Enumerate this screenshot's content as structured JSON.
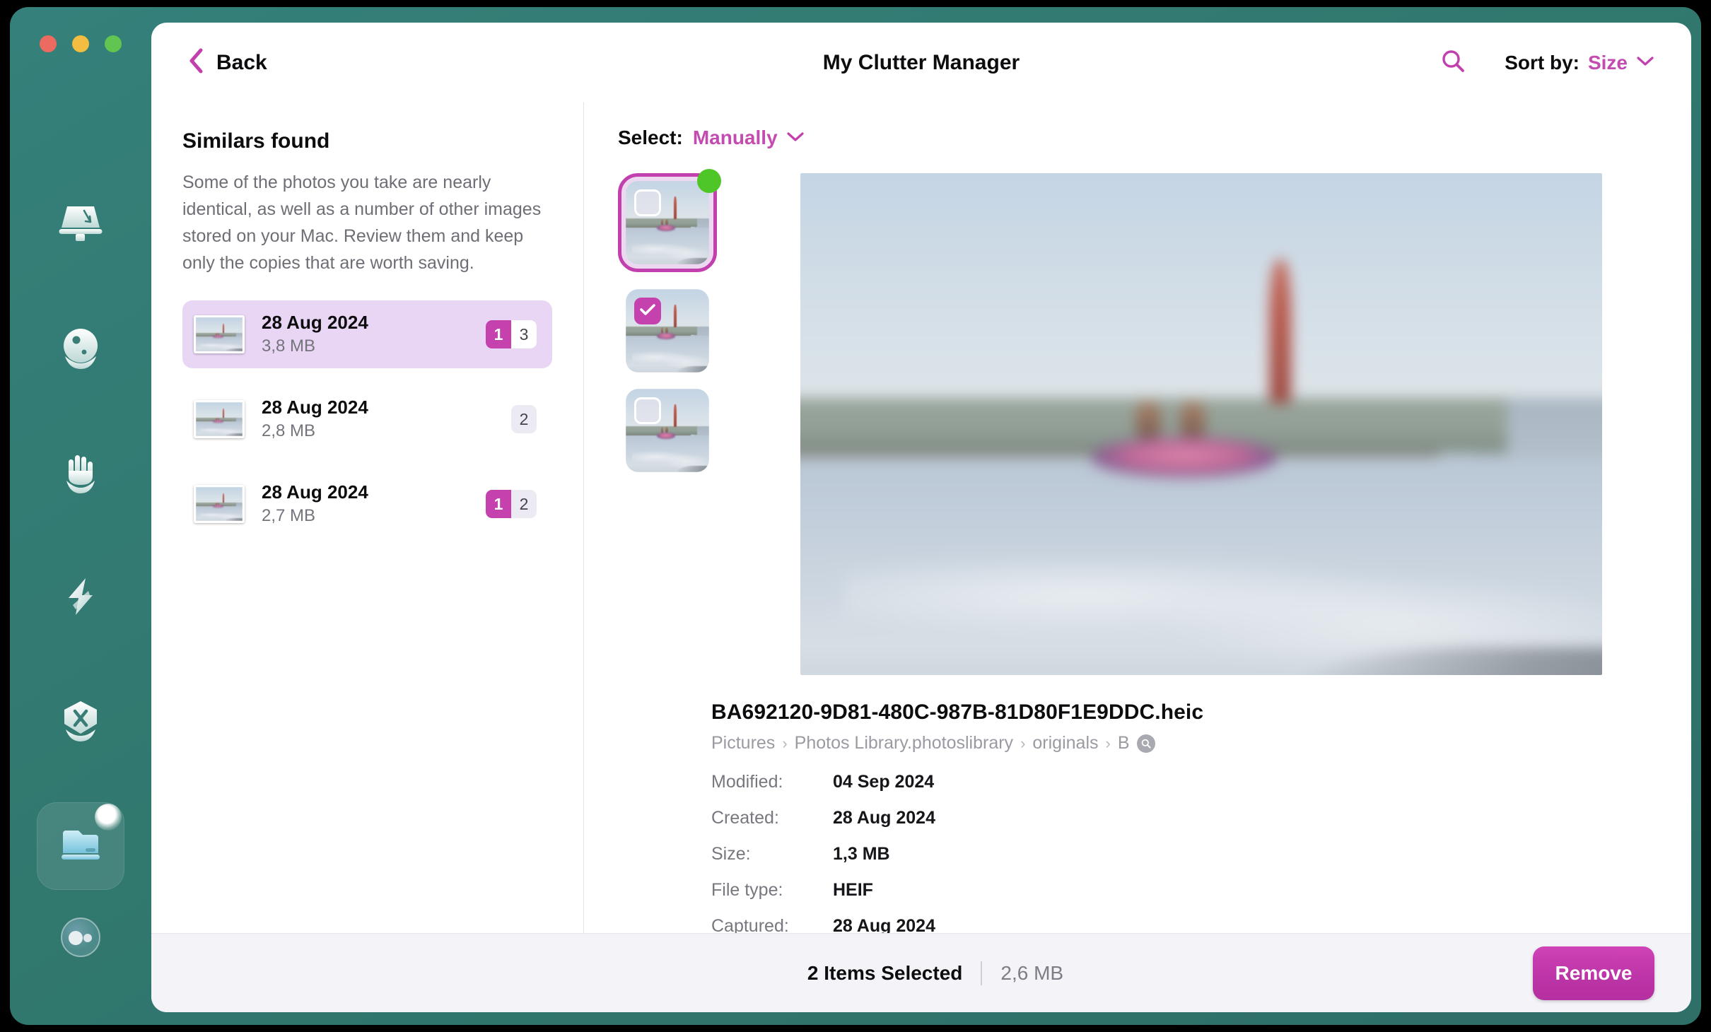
{
  "window": {
    "traffic_lights": [
      "close",
      "minimize",
      "zoom"
    ],
    "accent": "#c441ae",
    "shell_bg": "#327a72"
  },
  "rail": {
    "items": [
      {
        "name": "smart-care",
        "icon": "scanner-icon",
        "active": false
      },
      {
        "name": "cleanup",
        "icon": "droplet-icon",
        "active": false
      },
      {
        "name": "protection",
        "icon": "hand-icon",
        "active": false
      },
      {
        "name": "performance",
        "icon": "bolt-icon",
        "active": false
      },
      {
        "name": "applications",
        "icon": "shield-tools-icon",
        "active": false
      },
      {
        "name": "my-clutter",
        "icon": "folder-icon",
        "active": true,
        "badge_dot": true
      }
    ],
    "bottom_item": {
      "name": "assistant",
      "icon": "assistant-orb-icon"
    }
  },
  "header": {
    "back_label": "Back",
    "title": "My Clutter Manager",
    "search_icon": "search-icon",
    "sort_label": "Sort by:",
    "sort_value": "Size",
    "sort_chevron": "chevron-down-icon"
  },
  "left_pane": {
    "title": "Similars found",
    "description": "Some of the photos you take are nearly identical, as well as a number of other images stored on your Mac. Review them and keep only the copies that are worth saving.",
    "groups": [
      {
        "date": "28 Aug 2024",
        "size": "3,8 MB",
        "selected_count": "1",
        "total_count": "3",
        "active": true
      },
      {
        "date": "28 Aug 2024",
        "size": "2,8 MB",
        "selected_count": "",
        "total_count": "2",
        "active": false
      },
      {
        "date": "28 Aug 2024",
        "size": "2,7 MB",
        "selected_count": "1",
        "total_count": "2",
        "active": false
      }
    ]
  },
  "right_pane": {
    "select_label": "Select:",
    "select_value": "Manually",
    "select_chevron": "chevron-down-icon",
    "thumbnails": [
      {
        "checked": false,
        "current": true,
        "best_marker": true
      },
      {
        "checked": true,
        "current": false,
        "best_marker": false
      },
      {
        "checked": false,
        "current": false,
        "best_marker": false
      }
    ],
    "file_name": "BA692120-9D81-480C-987B-81D80F1E9DDC.heic",
    "path_parts": [
      "Pictures",
      "Photos Library.photoslibrary",
      "originals",
      "B"
    ],
    "path_separator": "›",
    "reveal_icon": "magnifier-icon",
    "metadata": [
      {
        "key": "Modified:",
        "value": "04 Sep 2024"
      },
      {
        "key": "Created:",
        "value": "28 Aug 2024"
      },
      {
        "key": "Size:",
        "value": "1,3 MB"
      },
      {
        "key": "File type:",
        "value": "HEIF"
      },
      {
        "key": "Captured:",
        "value": "28 Aug 2024"
      }
    ]
  },
  "footer": {
    "count_label": "2 Items Selected",
    "size_label": "2,6 MB",
    "remove_label": "Remove"
  }
}
